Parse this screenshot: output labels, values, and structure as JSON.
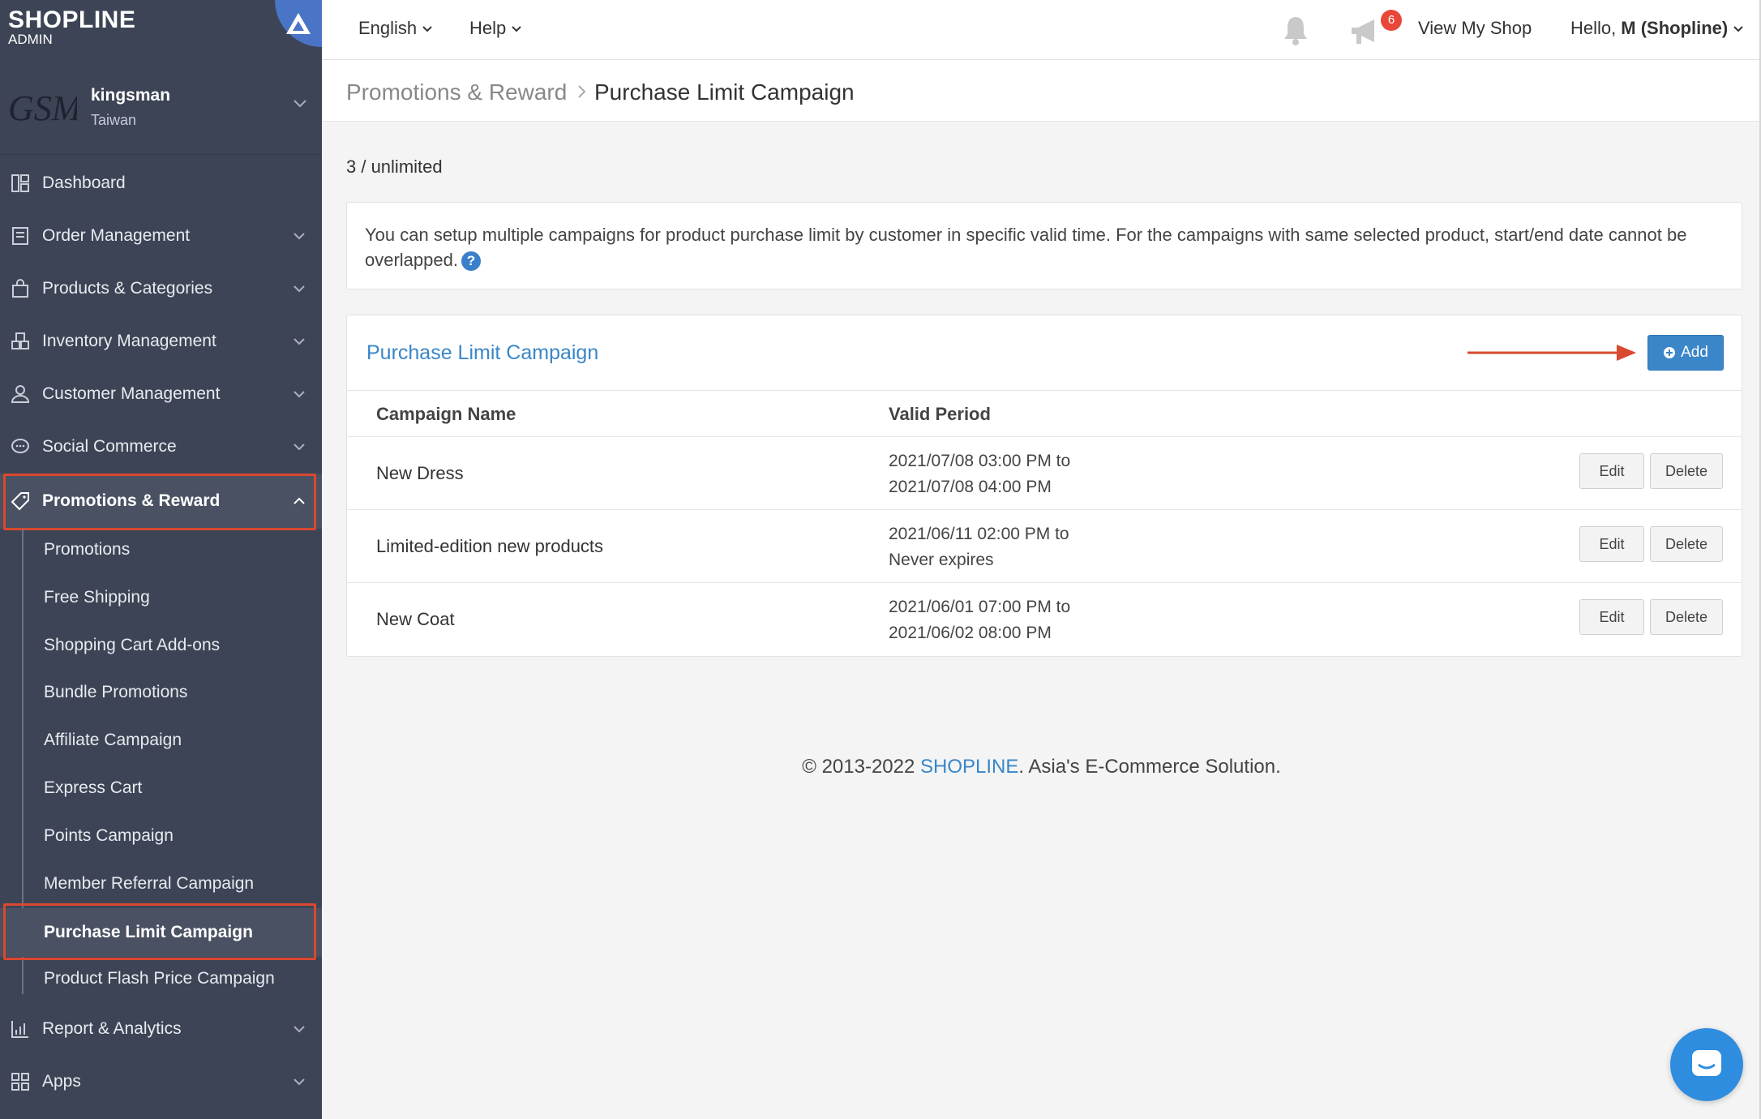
{
  "brand": {
    "logo": "SHOPLINE",
    "subtitle": "ADMIN"
  },
  "store": {
    "logo_text": "GSM",
    "name": "kingsman",
    "country": "Taiwan"
  },
  "sidebar": {
    "items": [
      {
        "label": "Dashboard",
        "icon": "dashboard-icon"
      },
      {
        "label": "Order Management",
        "icon": "order-icon"
      },
      {
        "label": "Products & Categories",
        "icon": "bag-icon"
      },
      {
        "label": "Inventory Management",
        "icon": "inventory-icon"
      },
      {
        "label": "Customer Management",
        "icon": "customer-icon"
      },
      {
        "label": "Social Commerce",
        "icon": "chat-bubble-icon"
      },
      {
        "label": "Promotions & Reward",
        "icon": "tag-icon"
      },
      {
        "label": "Report & Analytics",
        "icon": "report-icon"
      },
      {
        "label": "Apps",
        "icon": "apps-icon"
      }
    ],
    "promotions_sub": [
      "Promotions",
      "Free Shipping",
      "Shopping Cart Add-ons",
      "Bundle Promotions",
      "Affiliate Campaign",
      "Express Cart",
      "Points Campaign",
      "Member Referral Campaign",
      "Purchase Limit Campaign",
      "Product Flash Price Campaign"
    ]
  },
  "topbar": {
    "language": "English",
    "help": "Help",
    "notification_count": "6",
    "view_shop": "View My Shop",
    "greeting": "Hello,",
    "user": "M (Shopline)"
  },
  "breadcrumb": {
    "parent": "Promotions & Reward",
    "current": "Purchase Limit Campaign"
  },
  "quota": "3 / unlimited",
  "notice": "You can setup multiple campaigns for product purchase limit by customer in specific valid time. For the campaigns with same selected product, start/end date cannot be overlapped.",
  "panel": {
    "title": "Purchase Limit Campaign",
    "add_label": "Add",
    "columns": {
      "name": "Campaign Name",
      "period": "Valid Period"
    },
    "rows": [
      {
        "name": "New Dress",
        "start": "2021/07/08 03:00 PM to",
        "end": "2021/07/08 04:00 PM"
      },
      {
        "name": "Limited-edition new products",
        "start": "2021/06/11 02:00 PM to",
        "end": "Never expires"
      },
      {
        "name": "New Coat",
        "start": "2021/06/01 07:00 PM to",
        "end": "2021/06/02 08:00 PM"
      }
    ],
    "edit_label": "Edit",
    "delete_label": "Delete"
  },
  "footer": {
    "copyright": "© 2013-2022",
    "brand": "SHOPLINE",
    "tagline": ". Asia's E-Commerce Solution."
  },
  "colors": {
    "sidebar_bg": "#3d4455",
    "accent": "#3a86c8",
    "highlight": "#d9482f",
    "badge": "#e8473a"
  }
}
